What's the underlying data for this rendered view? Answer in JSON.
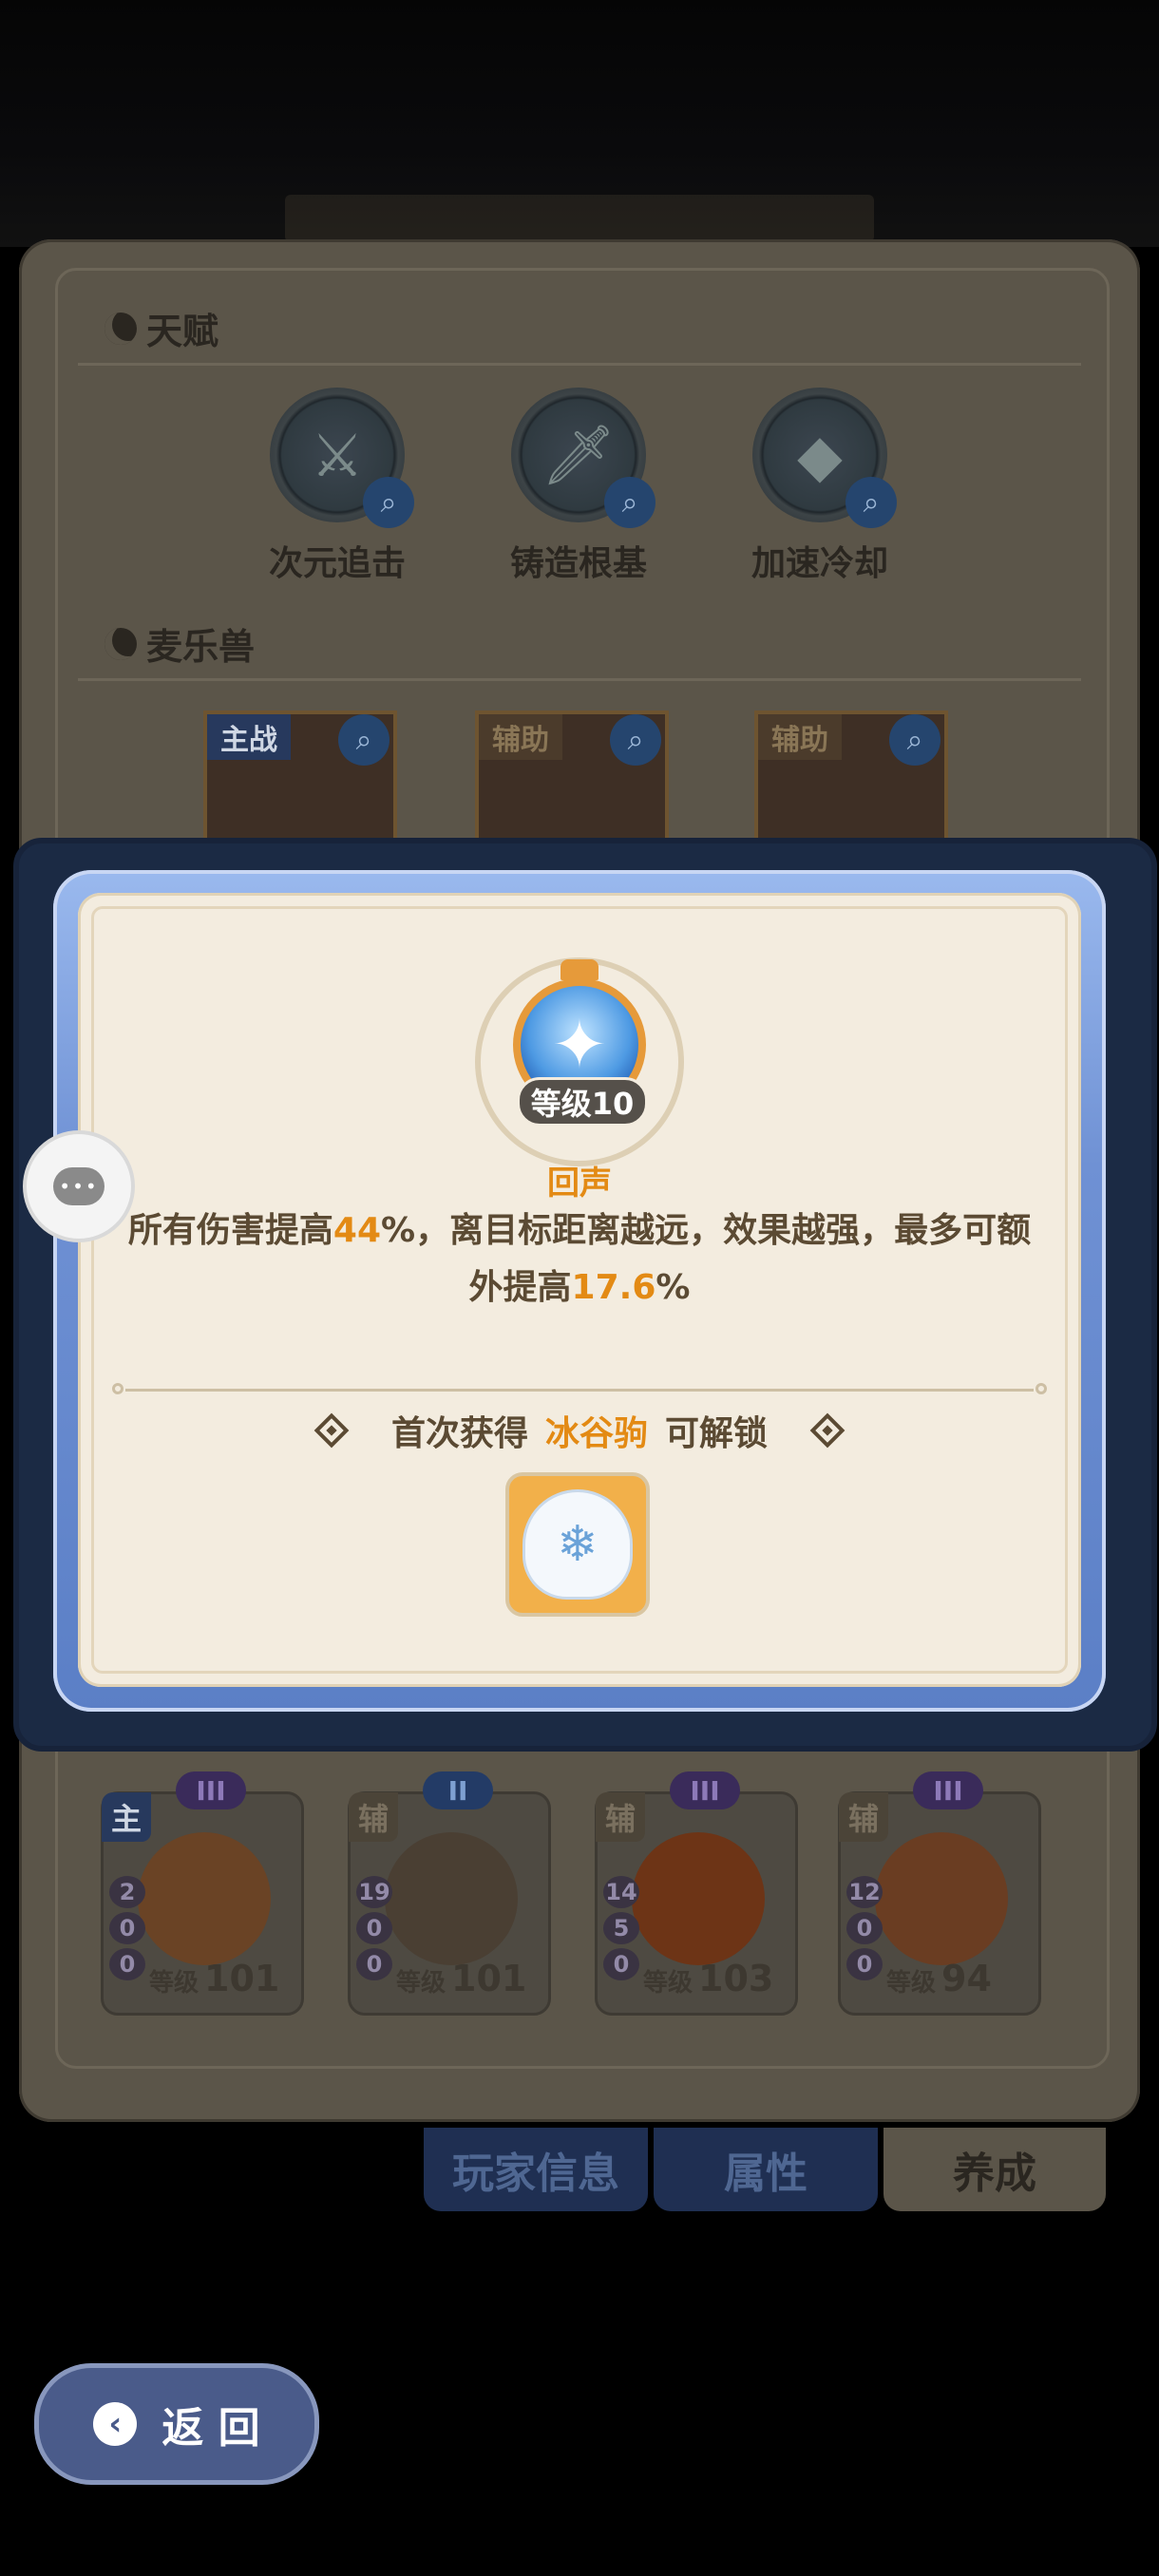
{
  "talents": {
    "title": "天赋",
    "items": [
      {
        "name": "次元追击",
        "icon": "crossed-swords-icon"
      },
      {
        "name": "铸造根基",
        "icon": "sword-icon"
      },
      {
        "name": "加速冷却",
        "icon": "rock-icon"
      }
    ]
  },
  "pets": {
    "title": "麦乐兽",
    "items": [
      {
        "role": "主战"
      },
      {
        "role": "辅助"
      },
      {
        "role": "辅助"
      }
    ]
  },
  "team": [
    {
      "role": "主",
      "rank": "III",
      "stats": [
        "2",
        "0",
        "0"
      ],
      "level_label": "等级",
      "level": "101"
    },
    {
      "role": "辅",
      "rank": "II",
      "stats": [
        "19",
        "0",
        "0"
      ],
      "level_label": "等级",
      "level": "101"
    },
    {
      "role": "辅",
      "rank": "III",
      "stats": [
        "14",
        "5",
        "0"
      ],
      "level_label": "等级",
      "level": "103"
    },
    {
      "role": "辅",
      "rank": "III",
      "stats": [
        "12",
        "0",
        "0"
      ],
      "level_label": "等级",
      "level": "94"
    }
  ],
  "tabs": [
    "玩家信息",
    "属性",
    "养成"
  ],
  "active_tab": "养成",
  "back_label": "返 回",
  "popup": {
    "level": "等级10",
    "skill_name": "回声",
    "desc_pre": "所有伤害提高",
    "desc_val1": "44",
    "desc_mid": "%，离目标距离越远，效果越强，最多可额外提高",
    "desc_val2": "17.6",
    "desc_post": "%",
    "unlock_pre": "首次获得",
    "unlock_pet": "冰谷驹",
    "unlock_post": "可解锁"
  },
  "colors": {
    "highlight": "#e38a14",
    "text": "#5b4a33",
    "frame_blue": "#6f91d4",
    "card_bg": "#f3ecdf"
  }
}
